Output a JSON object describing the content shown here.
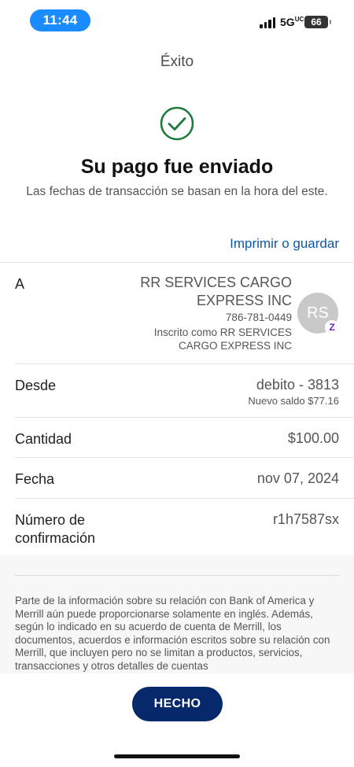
{
  "status_bar": {
    "time": "11:44",
    "network": "5G",
    "network_suffix": "UC",
    "battery": "66"
  },
  "nav": {
    "title": "Éxito"
  },
  "confirmation": {
    "headline": "Su pago fue enviado",
    "subline": "Las fechas de transacción se basan en la hora del este.",
    "print_link": "Imprimir o guardar"
  },
  "payee": {
    "label": "A",
    "name": "RR SERVICES CARGO EXPRESS INC",
    "phone": "786-781-0449",
    "enrolled": "Inscrito como RR SERVICES CARGO EXPRESS INC",
    "avatar_initials": "RS",
    "badge": "Z"
  },
  "from": {
    "label": "Desde",
    "value": "debito - 3813",
    "balance": "Nuevo saldo $77.16"
  },
  "amount": {
    "label": "Cantidad",
    "value": "$100.00"
  },
  "date": {
    "label": "Fecha",
    "value": "nov 07, 2024"
  },
  "confirmation_number": {
    "label_line1": "Número de",
    "label_line2": "confirmación",
    "value": "r1h7587sx"
  },
  "disclaimer": "Parte de la información sobre su relación con Bank of America y Merrill aún puede proporcionarse solamente en inglés. Además, según lo indicado en su acuerdo de cuenta de Merrill, los documentos, acuerdos e información escritos sobre su relación con Merrill, que incluyen pero no se limitan a productos, servicios, transacciones y otros detalles de cuentas",
  "done_button": "HECHO",
  "colors": {
    "accent_blue": "#1a8cff",
    "link": "#0b58a8",
    "success_green": "#1e7b3c",
    "button": "#06296c",
    "zelle_purple": "#6d1ed4"
  }
}
